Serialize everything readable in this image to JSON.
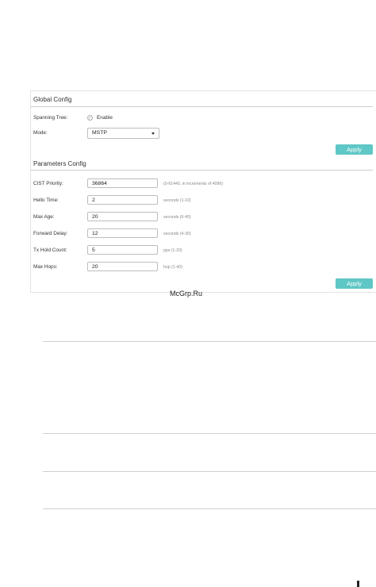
{
  "global_config": {
    "title": "Global Config",
    "spanning_tree_label": "Spanning Tree:",
    "enable_label": "Enable",
    "enable_checked": true,
    "mode_label": "Mode:",
    "mode_value": "MSTP",
    "apply_label": "Apply"
  },
  "parameters_config": {
    "title": "Parameters Config",
    "rows": [
      {
        "label": "CIST Priority:",
        "value": "36864",
        "hint": "(0-61440, in increments of 4096)"
      },
      {
        "label": "Hello Time:",
        "value": "2",
        "hint": "seconds (1-10)"
      },
      {
        "label": "Max Age:",
        "value": "20",
        "hint": "seconds (6-40)"
      },
      {
        "label": "Forward Delay:",
        "value": "12",
        "hint": "seconds (4-30)"
      },
      {
        "label": "Tx Hold Count:",
        "value": "5",
        "hint": "pps (1-20)"
      },
      {
        "label": "Max Hops:",
        "value": "20",
        "hint": "hop (1-40)"
      }
    ],
    "apply_label": "Apply"
  },
  "watermark": "McGrp.Ru"
}
